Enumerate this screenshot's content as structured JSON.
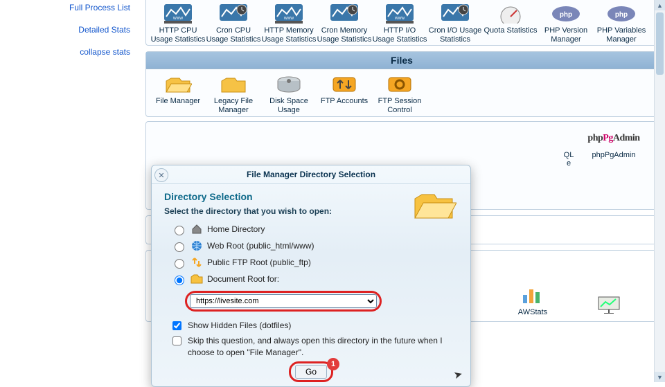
{
  "sidebar": {
    "items": [
      {
        "label": "Full Process List"
      },
      {
        "label": "Detailed Stats"
      },
      {
        "label": "collapse stats"
      }
    ]
  },
  "stats_section": {
    "items": [
      {
        "label": "HTTP CPU Usage Statistics",
        "iconColor": "#2d77a9"
      },
      {
        "label": "Cron CPU Usage Statistics",
        "iconColor": "#2d77a9"
      },
      {
        "label": "HTTP Memory Usage Statistics",
        "iconColor": "#2d77a9"
      },
      {
        "label": "Cron Memory Usage Statistics",
        "iconColor": "#2d77a9"
      },
      {
        "label": "HTTP I/O Usage Statistics",
        "iconColor": "#2d77a9"
      },
      {
        "label": "Cron I/O Usage Statistics",
        "iconColor": "#2d77a9"
      },
      {
        "label": "Quota Statistics",
        "iconColor": "#2d77a9"
      },
      {
        "label": "PHP Version Manager",
        "iconColor": "#6925b7"
      },
      {
        "label": "PHP Variables Manager",
        "iconColor": "#6925b7"
      }
    ]
  },
  "files_section": {
    "title": "Files",
    "items": [
      {
        "label": "File Manager"
      },
      {
        "label": "Legacy File Manager"
      },
      {
        "label": "Disk Space Usage"
      },
      {
        "label": "FTP Accounts"
      },
      {
        "label": "FTP Session Control"
      }
    ]
  },
  "db_peek": {
    "items": [
      {
        "label_fragment_left": "QL",
        "label_fragment_right": "e"
      },
      {
        "label": "phpPgAdmin"
      }
    ]
  },
  "bottom_peek": {
    "items": [
      {
        "label": "AWStats"
      },
      {
        "label": ""
      }
    ]
  },
  "modal": {
    "title": "File Manager Directory Selection",
    "heading": "Directory Selection",
    "prompt": "Select the directory that you wish to open:",
    "options": [
      {
        "label": "Home Directory"
      },
      {
        "label": "Web Root (public_html/www)"
      },
      {
        "label": "Public FTP Root (public_ftp)"
      },
      {
        "label": "Document Root for:"
      }
    ],
    "selected_index": 3,
    "select_value": "https://livesite.com",
    "show_hidden": {
      "label": "Show Hidden Files (dotfiles)",
      "checked": true
    },
    "skip_question": {
      "label": "Skip this question, and always open this directory in the future when I choose to open \"File Manager\".",
      "checked": false
    },
    "go_label": "Go",
    "badge": "1"
  }
}
